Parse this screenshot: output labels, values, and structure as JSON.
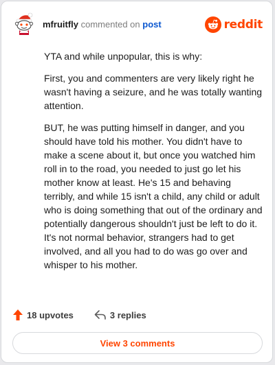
{
  "header": {
    "username": "mfruitfly",
    "action": "commented on",
    "target": "post",
    "brand": "reddit"
  },
  "comment": {
    "paragraphs": [
      "YTA and while unpopular, this is why:",
      "First, you and commenters are very likely right he wasn't having a seizure, and he was totally wanting attention.",
      "BUT, he was putting himself in danger, and you should have told his mother. You didn't have to make a scene about it, but once you watched him roll in to the road, you needed to just go let his mother know at least. He's 15 and behaving terribly, and while 15 isn't a child, any child or adult who is doing something that out of the ordinary and potentially dangerous shouldn't just be left to do it. It's not normal behavior, strangers had to get involved, and all you had to do was go over and whisper to his mother."
    ]
  },
  "footer": {
    "upvotes": "18 upvotes",
    "replies": "3 replies",
    "view_button": "View 3 comments"
  },
  "colors": {
    "accent": "#ff4500",
    "link": "#0b57d0"
  },
  "icons": {
    "avatar": "reddit-snoo-avatar",
    "brand": "reddit-logo-icon",
    "upvote": "upvote-arrow-icon",
    "reply": "reply-arrow-icon"
  }
}
